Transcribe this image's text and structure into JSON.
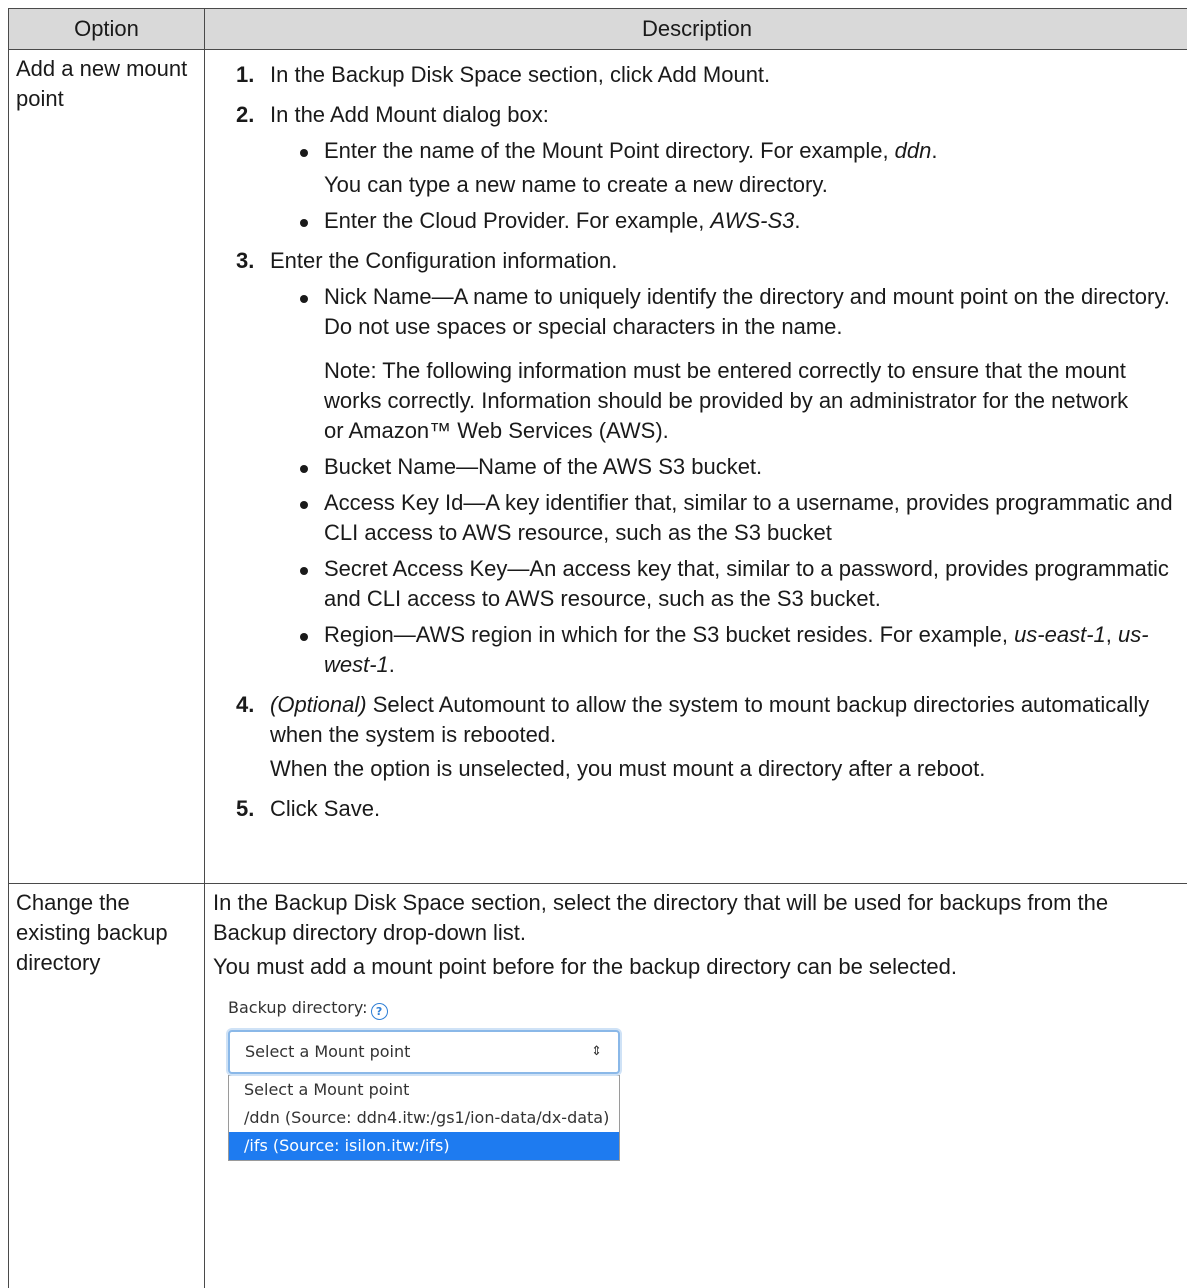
{
  "table": {
    "header": {
      "option": "Option",
      "description": "Description"
    },
    "row1": {
      "option": "Add a new mount point",
      "steps": {
        "s1": {
          "num": "1.",
          "p1": "In the ",
          "b1": "Backup Disk Space",
          "p2": " section, click ",
          "b2": "Add Mount",
          "p3": "."
        },
        "s2": {
          "num": "2.",
          "p1": "In the ",
          "b1": "Add Mount",
          "p2": " dialog box:",
          "bullets": {
            "a": {
              "p1": "Enter the name of the ",
              "b1": "Mount Point directory",
              "p2": ". For example, ",
              "i1": "ddn",
              "p3": ".",
              "sub": "You can type a new name to create a new directory."
            },
            "b": {
              "p1": "Enter the ",
              "b1": "Cloud Provider",
              "p2": ". For example, ",
              "i1": "AWS-S3",
              "p3": "."
            }
          }
        },
        "s3": {
          "num": "3.",
          "p1": "Enter the ",
          "b1": "Configuration",
          "p2": " information.",
          "bullets": {
            "nick": {
              "b1": "Nick Name",
              "p1": "—A name to uniquely identify the directory and mount point on the directory. Do not use spaces or special characters in the name."
            },
            "note": {
              "b1": "Note:",
              "p1": "  The following information must be entered correctly to ensure that the mount works correctly. Information should be provided by an administrator for the network or Amazon™ Web Services (AWS)."
            },
            "bucket": {
              "b1": "Bucket Name",
              "p1": "—Name of the AWS S3 bucket."
            },
            "access": {
              "b1": "Access Key Id",
              "p1": "—A key identifier that, similar to a username, provides programmatic and CLI access to AWS resource, such as the S3 bucket"
            },
            "secret": {
              "b1": "Secret Access Key",
              "p1": "—An access key that, similar to a password, provides programmatic and CLI access to AWS resource, such as the S3 bucket."
            },
            "region": {
              "b1": "Region",
              "p1": "—AWS region in which for the S3 bucket resides. For example, ",
              "i1": "us-east-1",
              "p2": ", ",
              "i2": "us-west-1",
              "p3": "."
            }
          }
        },
        "s4": {
          "num": "4.",
          "i1": "(Optional)",
          "p1": " Select ",
          "b1": "Automount",
          "p2": " to allow the system to mount backup directories automatically when the system is rebooted.",
          "sub": "When the option is unselected, you must mount a directory after a reboot."
        },
        "s5": {
          "num": "5.",
          "p1": "Click ",
          "b1": "Save",
          "p2": "."
        }
      }
    },
    "row2": {
      "option": "Change the existing backup directory",
      "para1": {
        "p1": "In the ",
        "b1": "Backup Disk Space",
        "p2": " section, select the directory that will be used for backups from the ",
        "b2": "Backup directory",
        "p3": " drop-down list."
      },
      "para2": "You must add a mount point before for the backup directory can be selected.",
      "ui": {
        "label": "Backup directory:",
        "help_icon": "?",
        "select_value": "Select a Mount point",
        "arrow": "⇕",
        "options": [
          "Select a Mount point",
          "/ddn (Source: ddn4.itw:/gs1/ion-data/dx-data)",
          "/ifs (Source: isilon.itw:/ifs)"
        ],
        "selected_option_color": "#1e7bf0"
      }
    }
  }
}
